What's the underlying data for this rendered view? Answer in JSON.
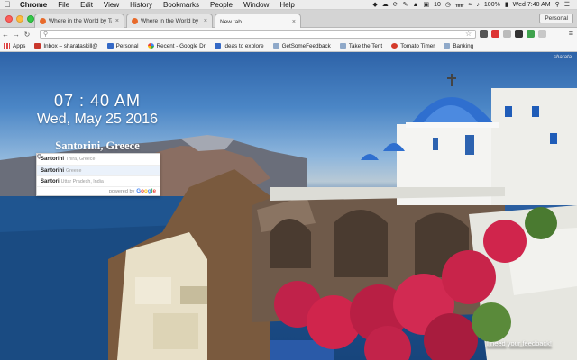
{
  "menubar": {
    "app": "Chrome",
    "items": [
      "File",
      "Edit",
      "View",
      "History",
      "Bookmarks",
      "People",
      "Window",
      "Help"
    ],
    "tray_count": "10",
    "battery": "100%",
    "clock": "Wed 7:40 AM"
  },
  "tabs": [
    {
      "title": "Where in the World by Tab",
      "active": false
    },
    {
      "title": "Where in the World by Tab",
      "active": false
    },
    {
      "title": "New tab",
      "active": true
    }
  ],
  "profile_button": "Personal",
  "omnibox": {
    "value": "",
    "placeholder": ""
  },
  "bookmarks": [
    {
      "label": "Apps",
      "icon": "apps-icon"
    },
    {
      "label": "Inbox – sharataskill@",
      "icon": "mail-icon"
    },
    {
      "label": "Personal",
      "icon": "bookmark-icon"
    },
    {
      "label": "Recent - Google Dr",
      "icon": "google-icon"
    },
    {
      "label": "Ideas to explore",
      "icon": "bookmark-icon"
    },
    {
      "label": "GetSomeFeedback",
      "icon": "folder-icon"
    },
    {
      "label": "Take the Tent",
      "icon": "folder-icon"
    },
    {
      "label": "Tomato Timer",
      "icon": "tomato-icon"
    },
    {
      "label": "Banking",
      "icon": "folder-icon"
    }
  ],
  "page": {
    "time": "07 : 40 AM",
    "date": "Wed, May 25 2016",
    "location": "Santorini, Greece",
    "watermark": "sharata",
    "suggestions": [
      {
        "main": "Santorini",
        "sub": "Thira, Greece",
        "selected": false
      },
      {
        "main": "Santorini",
        "sub": "Greece",
        "selected": true
      },
      {
        "main": "Santori",
        "sub": "Uttar Pradesh, India",
        "selected": false
      }
    ],
    "powered_by": "powered by",
    "powered_brand": "Google",
    "feedback_link": "I need your feedback!"
  },
  "colors": {
    "sky": "#2e63a8",
    "sea": "#1e4f8c",
    "dome": "#2f6fcf",
    "flowers": "#d0254c",
    "pin_red": "#e0332a"
  }
}
